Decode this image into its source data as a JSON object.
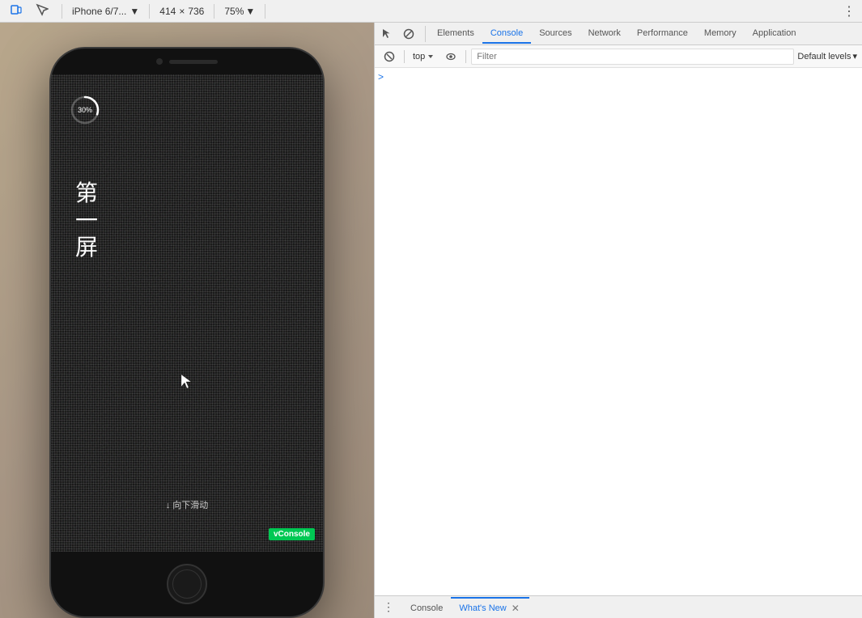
{
  "toolbar": {
    "device_label": "iPhone 6/7...",
    "device_arrow": "▼",
    "width": "414",
    "separator": "×",
    "height": "736",
    "zoom": "75%",
    "zoom_arrow": "▼",
    "more_icon": "⋮"
  },
  "devtools": {
    "tabs": [
      {
        "id": "elements",
        "label": "Elements",
        "active": false
      },
      {
        "id": "console",
        "label": "Console",
        "active": true
      },
      {
        "id": "sources",
        "label": "Sources",
        "active": false
      },
      {
        "id": "network",
        "label": "Network",
        "active": false
      },
      {
        "id": "performance",
        "label": "Performance",
        "active": false
      },
      {
        "id": "memory",
        "label": "Memory",
        "active": false
      },
      {
        "id": "application",
        "label": "Application",
        "active": false
      }
    ],
    "console_toolbar": {
      "context_label": "top",
      "filter_placeholder": "Filter",
      "log_level_label": "Default levels",
      "log_level_arrow": "▾"
    },
    "console_prompt_arrow": ">"
  },
  "bottom_tabs": [
    {
      "id": "console-tab",
      "label": "Console",
      "active": false,
      "closeable": false
    },
    {
      "id": "whats-new-tab",
      "label": "What's New",
      "active": true,
      "closeable": true
    }
  ],
  "device": {
    "model": "iPhone 6/7...",
    "progress_percent": "30%",
    "chinese_line1": "第",
    "chinese_line2": "一",
    "chinese_line3": "屏",
    "scroll_text": "↓ 向下滑动",
    "vconsole_label": "vConsole"
  },
  "colors": {
    "accent_blue": "#1a73e8",
    "tab_active_underline": "#1a73e8",
    "vconsole_green": "#00c853",
    "progress_circle_stroke": "#ffffff",
    "progress_bg_stroke": "rgba(255,255,255,0.3)"
  }
}
